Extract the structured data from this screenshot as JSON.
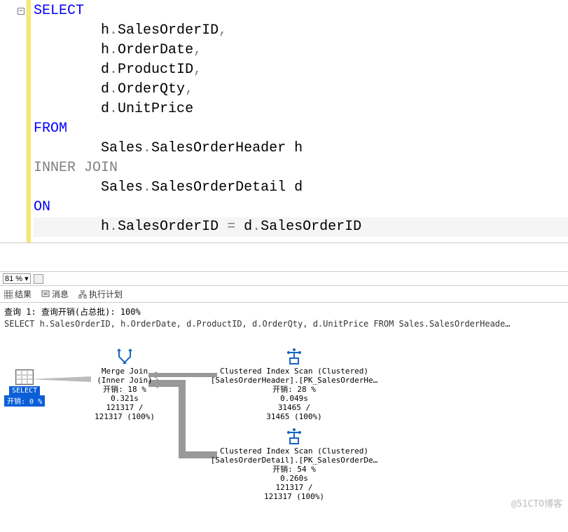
{
  "editor": {
    "lines": [
      {
        "indent": "",
        "tokens": [
          {
            "t": "SELECT",
            "c": "k-blue"
          }
        ]
      },
      {
        "indent": "        ",
        "tokens": [
          {
            "t": "h",
            "c": "txt"
          },
          {
            "t": ".",
            "c": "op"
          },
          {
            "t": "SalesOrderID",
            "c": "txt"
          },
          {
            "t": ",",
            "c": "op"
          }
        ]
      },
      {
        "indent": "        ",
        "tokens": [
          {
            "t": "h",
            "c": "txt"
          },
          {
            "t": ".",
            "c": "op"
          },
          {
            "t": "OrderDate",
            "c": "txt"
          },
          {
            "t": ",",
            "c": "op"
          }
        ]
      },
      {
        "indent": "        ",
        "tokens": [
          {
            "t": "d",
            "c": "txt"
          },
          {
            "t": ".",
            "c": "op"
          },
          {
            "t": "ProductID",
            "c": "txt"
          },
          {
            "t": ",",
            "c": "op"
          }
        ]
      },
      {
        "indent": "        ",
        "tokens": [
          {
            "t": "d",
            "c": "txt"
          },
          {
            "t": ".",
            "c": "op"
          },
          {
            "t": "OrderQty",
            "c": "txt"
          },
          {
            "t": ",",
            "c": "op"
          }
        ]
      },
      {
        "indent": "        ",
        "tokens": [
          {
            "t": "d",
            "c": "txt"
          },
          {
            "t": ".",
            "c": "op"
          },
          {
            "t": "UnitPrice",
            "c": "txt"
          }
        ]
      },
      {
        "indent": "",
        "tokens": [
          {
            "t": "FROM",
            "c": "k-blue"
          }
        ]
      },
      {
        "indent": "        ",
        "tokens": [
          {
            "t": "Sales",
            "c": "txt"
          },
          {
            "t": ".",
            "c": "op"
          },
          {
            "t": "SalesOrderHeader",
            "c": "txt"
          },
          {
            "t": " h",
            "c": "txt"
          }
        ]
      },
      {
        "indent": "",
        "tokens": [
          {
            "t": "INNER",
            "c": "k-gray"
          },
          {
            "t": " ",
            "c": "txt"
          },
          {
            "t": "JOIN",
            "c": "k-gray"
          }
        ]
      },
      {
        "indent": "        ",
        "tokens": [
          {
            "t": "Sales",
            "c": "txt"
          },
          {
            "t": ".",
            "c": "op"
          },
          {
            "t": "SalesOrderDetail",
            "c": "txt"
          },
          {
            "t": " d",
            "c": "txt"
          }
        ]
      },
      {
        "indent": "",
        "tokens": [
          {
            "t": "ON",
            "c": "k-blue"
          }
        ]
      },
      {
        "indent": "        ",
        "tokens": [
          {
            "t": "h",
            "c": "txt"
          },
          {
            "t": ".",
            "c": "op"
          },
          {
            "t": "SalesOrderID ",
            "c": "txt"
          },
          {
            "t": "=",
            "c": "op"
          },
          {
            "t": " d",
            "c": "txt"
          },
          {
            "t": ".",
            "c": "op"
          },
          {
            "t": "SalesOrderID",
            "c": "txt"
          }
        ],
        "last": true
      }
    ],
    "fold_symbol": "−"
  },
  "zoom": {
    "value": "81 %"
  },
  "tabs": {
    "results": "结果",
    "messages": "消息",
    "plan": "执行计划"
  },
  "query_header": "查询 1: 查询开销(占总批): 100%",
  "query_sql": "SELECT h.SalesOrderID, h.OrderDate, d.ProductID, d.OrderQty, d.UnitPrice FROM Sales.SalesOrderHeade…",
  "plan": {
    "select": {
      "label": "SELECT",
      "cost": "开销: 0 %"
    },
    "merge": {
      "l1": "Merge Join",
      "l2": "(Inner Join)",
      "l3": "开销: 18 %",
      "l4": "0.321s",
      "l5": "121317 /",
      "l6": "121317 (100%)"
    },
    "scan1": {
      "l1": "Clustered Index Scan (Clustered)",
      "l2": "[SalesOrderHeader].[PK_SalesOrderHe…",
      "l3": "开销: 28 %",
      "l4": "0.049s",
      "l5": "31465 /",
      "l6": "31465 (100%)"
    },
    "scan2": {
      "l1": "Clustered Index Scan (Clustered)",
      "l2": "[SalesOrderDetail].[PK_SalesOrderDe…",
      "l3": "开销: 54 %",
      "l4": "0.260s",
      "l5": "121317 /",
      "l6": "121317 (100%)"
    }
  },
  "watermark": "@51CTO博客"
}
